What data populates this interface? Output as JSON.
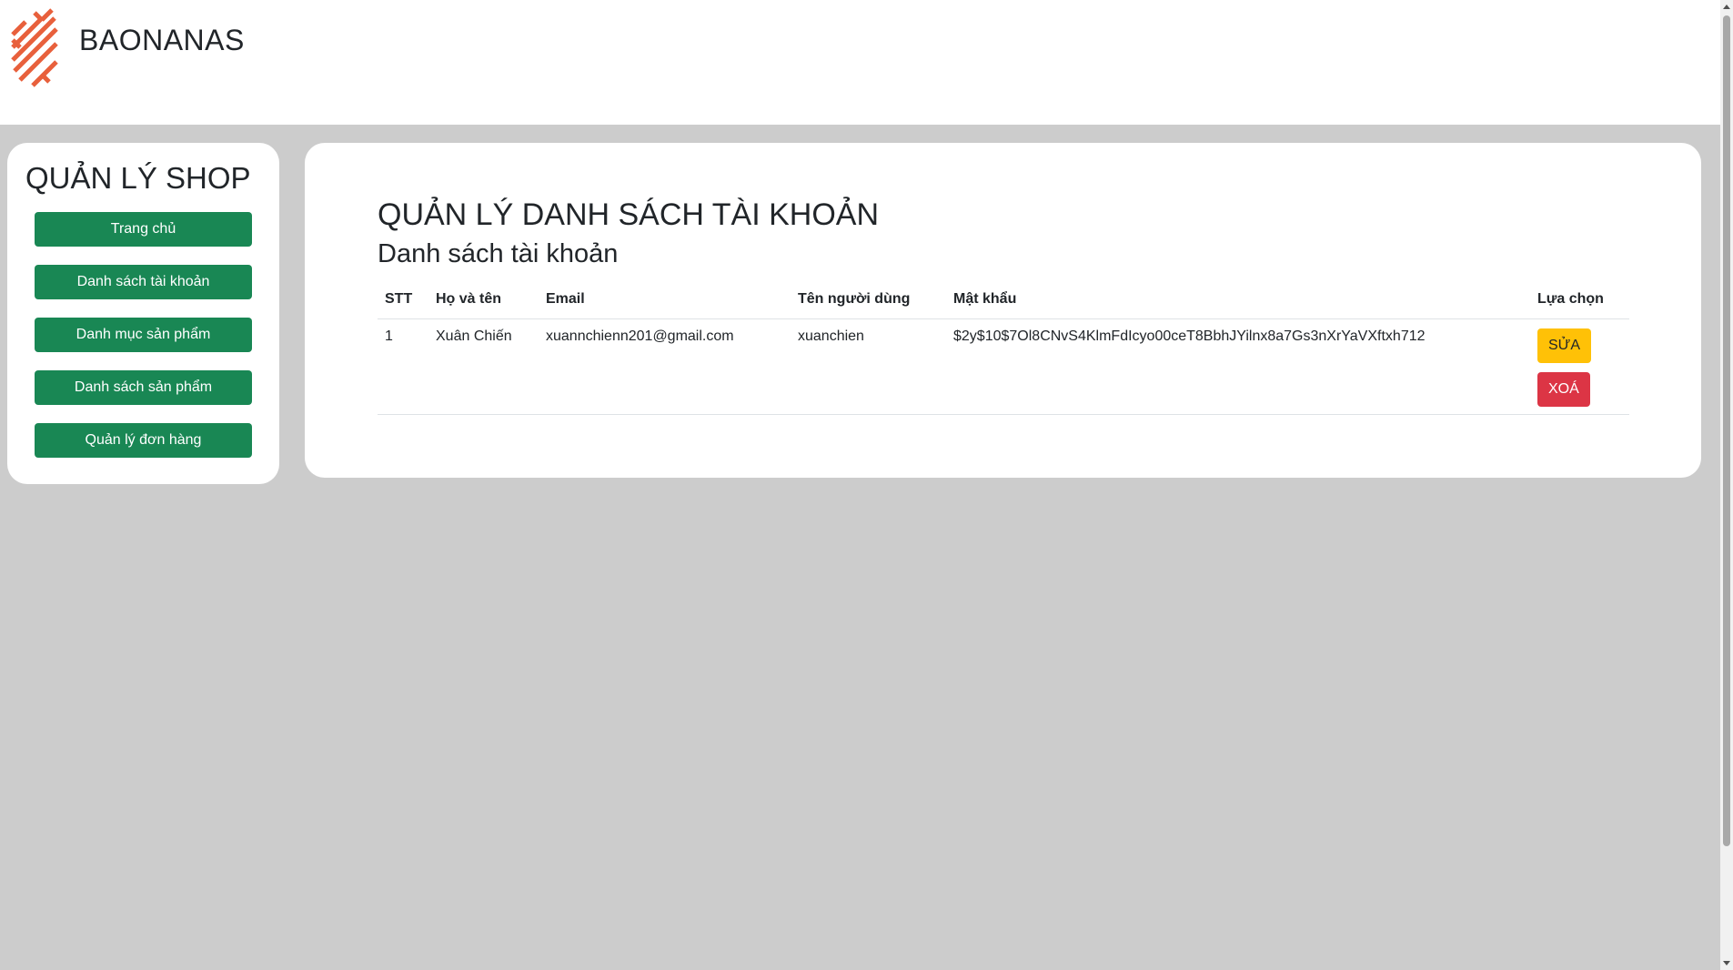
{
  "header": {
    "brand": "BAONANAS",
    "logo_icon": "striped-logo-icon",
    "accent_color": "#e8603c"
  },
  "sidebar": {
    "title": "QUẢN LÝ SHOP",
    "items": [
      {
        "label": "Trang chủ"
      },
      {
        "label": "Danh sách tài khoản"
      },
      {
        "label": "Danh mục sản phẩm"
      },
      {
        "label": "Danh sách sản phẩm"
      },
      {
        "label": "Quản lý đơn hàng"
      }
    ],
    "button_color": "#198754"
  },
  "main": {
    "page_title": "QUẢN LÝ DANH SÁCH TÀI KHOẢN",
    "section_title": "Danh sách tài khoản",
    "table": {
      "headers": [
        "STT",
        "Họ và tên",
        "Email",
        "Tên người dùng",
        "Mật khẩu",
        "Lựa chọn"
      ],
      "rows": [
        {
          "stt": "1",
          "name": "Xuân Chiến",
          "email": "xuannchienn201@gmail.com",
          "username": "xuanchien",
          "password": "$2y$10$7Ol8CNvS4KlmFdIcyo00ceT8BbhJYilnx8a7Gs3nXrYaVXftxh712",
          "edit_label": "SỬA",
          "delete_label": "XOÁ"
        }
      ]
    },
    "edit_color": "#ffc107",
    "delete_color": "#dc3545"
  }
}
